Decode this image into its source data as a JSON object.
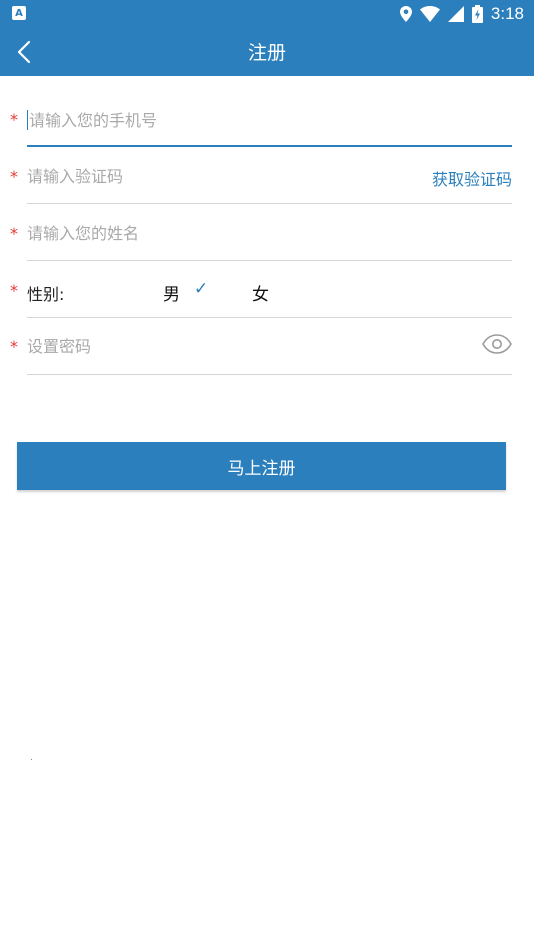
{
  "status_bar": {
    "left_icon_letter": "A",
    "time": "3:18"
  },
  "app_bar": {
    "title": "注册",
    "back_icon": "chevron-left-icon"
  },
  "form": {
    "required_mark": "*",
    "phone_placeholder": "请输入您的手机号",
    "code_placeholder": "请输入验证码",
    "get_code_label": "获取验证码",
    "name_placeholder": "请输入您的姓名",
    "gender_label": "性别:",
    "gender_male": "男",
    "gender_female": "女",
    "gender_selected": "男",
    "check_mark": "✓",
    "password_placeholder": "设置密码",
    "eye_icon": "eye-icon"
  },
  "submit_label": "马上注册",
  "colors": {
    "primary": "#2b7fbd",
    "required": "#e53935",
    "placeholder": "#a9a9a9",
    "divider": "#d6d6d6"
  }
}
